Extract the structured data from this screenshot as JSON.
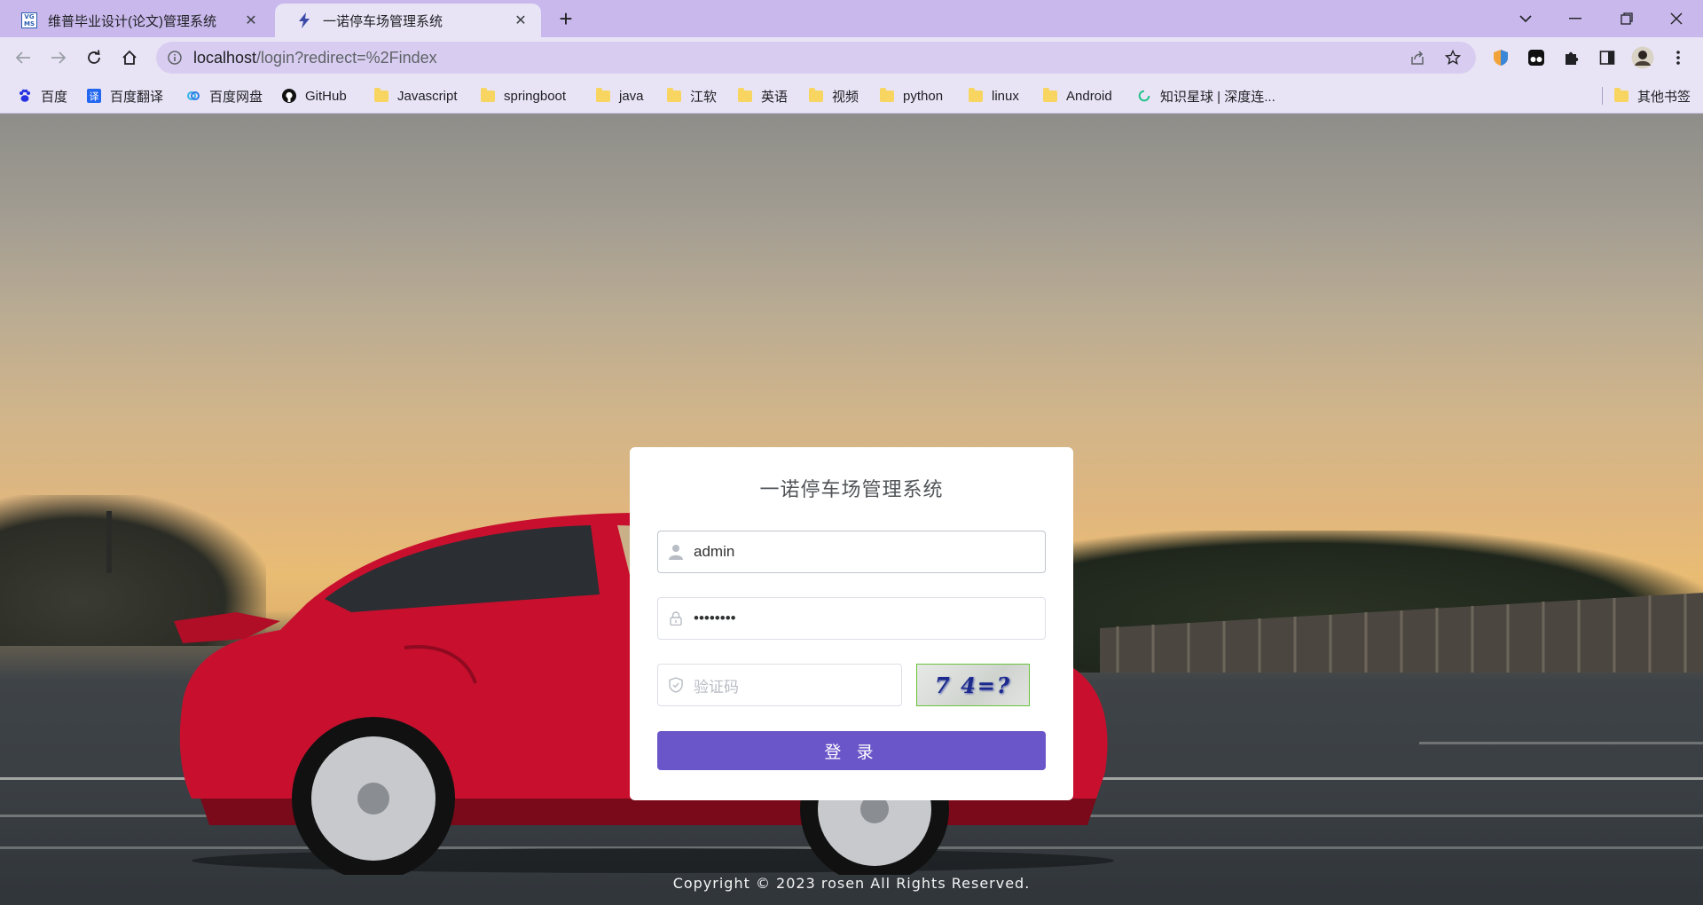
{
  "browser": {
    "tabs": [
      {
        "title": "维普毕业设计(论文)管理系统",
        "favicon": "vgms-logo",
        "active": false
      },
      {
        "title": "一诺停车场管理系统",
        "favicon": "lightning-icon",
        "active": true
      }
    ],
    "url_host": "localhost",
    "url_path": "/login?redirect=%2Findex",
    "bookmarks": [
      {
        "label": "百度",
        "icon": "baidu-paw-icon"
      },
      {
        "label": "百度翻译",
        "icon": "translate-icon"
      },
      {
        "label": "百度网盘",
        "icon": "cloud-icon"
      },
      {
        "label": "GitHub",
        "icon": "github-icon"
      },
      {
        "label": "Javascript",
        "icon": "folder-icon"
      },
      {
        "label": "springboot",
        "icon": "folder-icon"
      },
      {
        "label": "java",
        "icon": "folder-icon"
      },
      {
        "label": "江软",
        "icon": "folder-icon"
      },
      {
        "label": "英语",
        "icon": "folder-icon"
      },
      {
        "label": "视频",
        "icon": "folder-icon"
      },
      {
        "label": "python",
        "icon": "folder-icon"
      },
      {
        "label": "linux",
        "icon": "folder-icon"
      },
      {
        "label": "Android",
        "icon": "folder-icon"
      },
      {
        "label": "知识星球 | 深度连...",
        "icon": "zsxq-icon"
      }
    ],
    "other_bookmarks": "其他书签"
  },
  "login": {
    "title": "一诺停车场管理系统",
    "username": "admin",
    "password_masked": "••••••••",
    "captcha_placeholder": "验证码",
    "captcha_text": "7 4=?",
    "submit_label": "登 录"
  },
  "footer": {
    "copyright": "Copyright © 2023 rosen All Rights Reserved."
  },
  "colors": {
    "tabstrip": "#c8b8ec",
    "toolbar": "#e8e4f6",
    "primary_button": "#6a56c8",
    "captcha_border": "#67c23a"
  }
}
